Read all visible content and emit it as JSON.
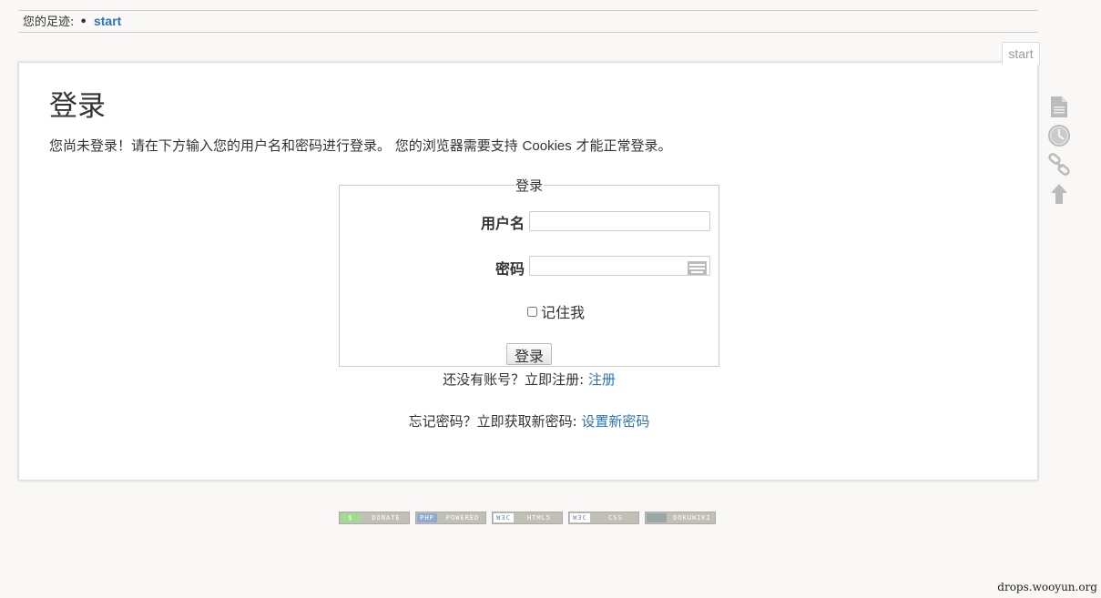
{
  "breadcrumbs": {
    "label": "您的足迹:",
    "separator": "•",
    "items": [
      {
        "label": "start"
      }
    ]
  },
  "page_tab": "start",
  "title": "登录",
  "intro": {
    "before": "您尚未登录！请在下方输入您的用户名和密码进行登录。 您的浏览器需要支持 ",
    "cookies": "Cookies",
    "after": " 才能正常登录。"
  },
  "form": {
    "legend": "登录",
    "username_label": "用户名",
    "username_value": "",
    "password_label": "密码",
    "password_value": "",
    "remember_label": "记住我",
    "remember_checked": false,
    "submit_label": "登录"
  },
  "register": {
    "text": "还没有账号？立即注册: ",
    "link": "注册"
  },
  "reset": {
    "text": "忘记密码？立即获取新密码: ",
    "link": "设置新密码"
  },
  "pagetools": [
    {
      "name": "show-page",
      "icon": "document-icon"
    },
    {
      "name": "old-revisions",
      "icon": "clock-icon"
    },
    {
      "name": "backlinks",
      "icon": "link-icon"
    },
    {
      "name": "back-to-top",
      "icon": "arrow-up-icon"
    }
  ],
  "badges": [
    {
      "left": "$",
      "right": "DONATE",
      "left_color": "#a0dc8c"
    },
    {
      "left": "PHP",
      "right": "POWERED",
      "left_color": "#8fa9cf"
    },
    {
      "left": "W3C",
      "right": "HTML5",
      "left_color": "#ffffff"
    },
    {
      "left": "W3C",
      "right": "CSS",
      "left_color": "#ffffff"
    },
    {
      "left": "",
      "right": "DOKUWIKI",
      "left_color": "#9aa7a6"
    }
  ],
  "watermark": "drops.wooyun.org"
}
